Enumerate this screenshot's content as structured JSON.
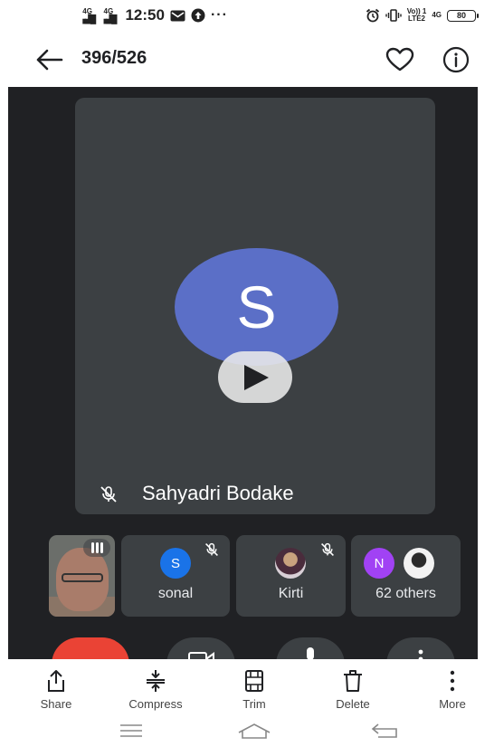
{
  "status_bar": {
    "network1": "4G",
    "network2": "4G",
    "time": "12:50",
    "volte_label_top": "Vo)) 1",
    "volte_label_bottom": "LTE2",
    "network3": "4G",
    "battery": "80"
  },
  "header": {
    "counter": "396/526"
  },
  "call": {
    "speaker": {
      "initial": "S",
      "name": "Sahyadri Bodake",
      "avatar_color": "#5b6fc7"
    },
    "participants": [
      {
        "initial": "S",
        "name": "sonal",
        "avatar_color": "#1a73e8"
      },
      {
        "name": "Kirti"
      },
      {
        "initial": "N",
        "name": "62 others",
        "avatar_color": "#a142f4"
      }
    ]
  },
  "toolbar": {
    "share": "Share",
    "compress": "Compress",
    "trim": "Trim",
    "delete": "Delete",
    "more": "More"
  }
}
